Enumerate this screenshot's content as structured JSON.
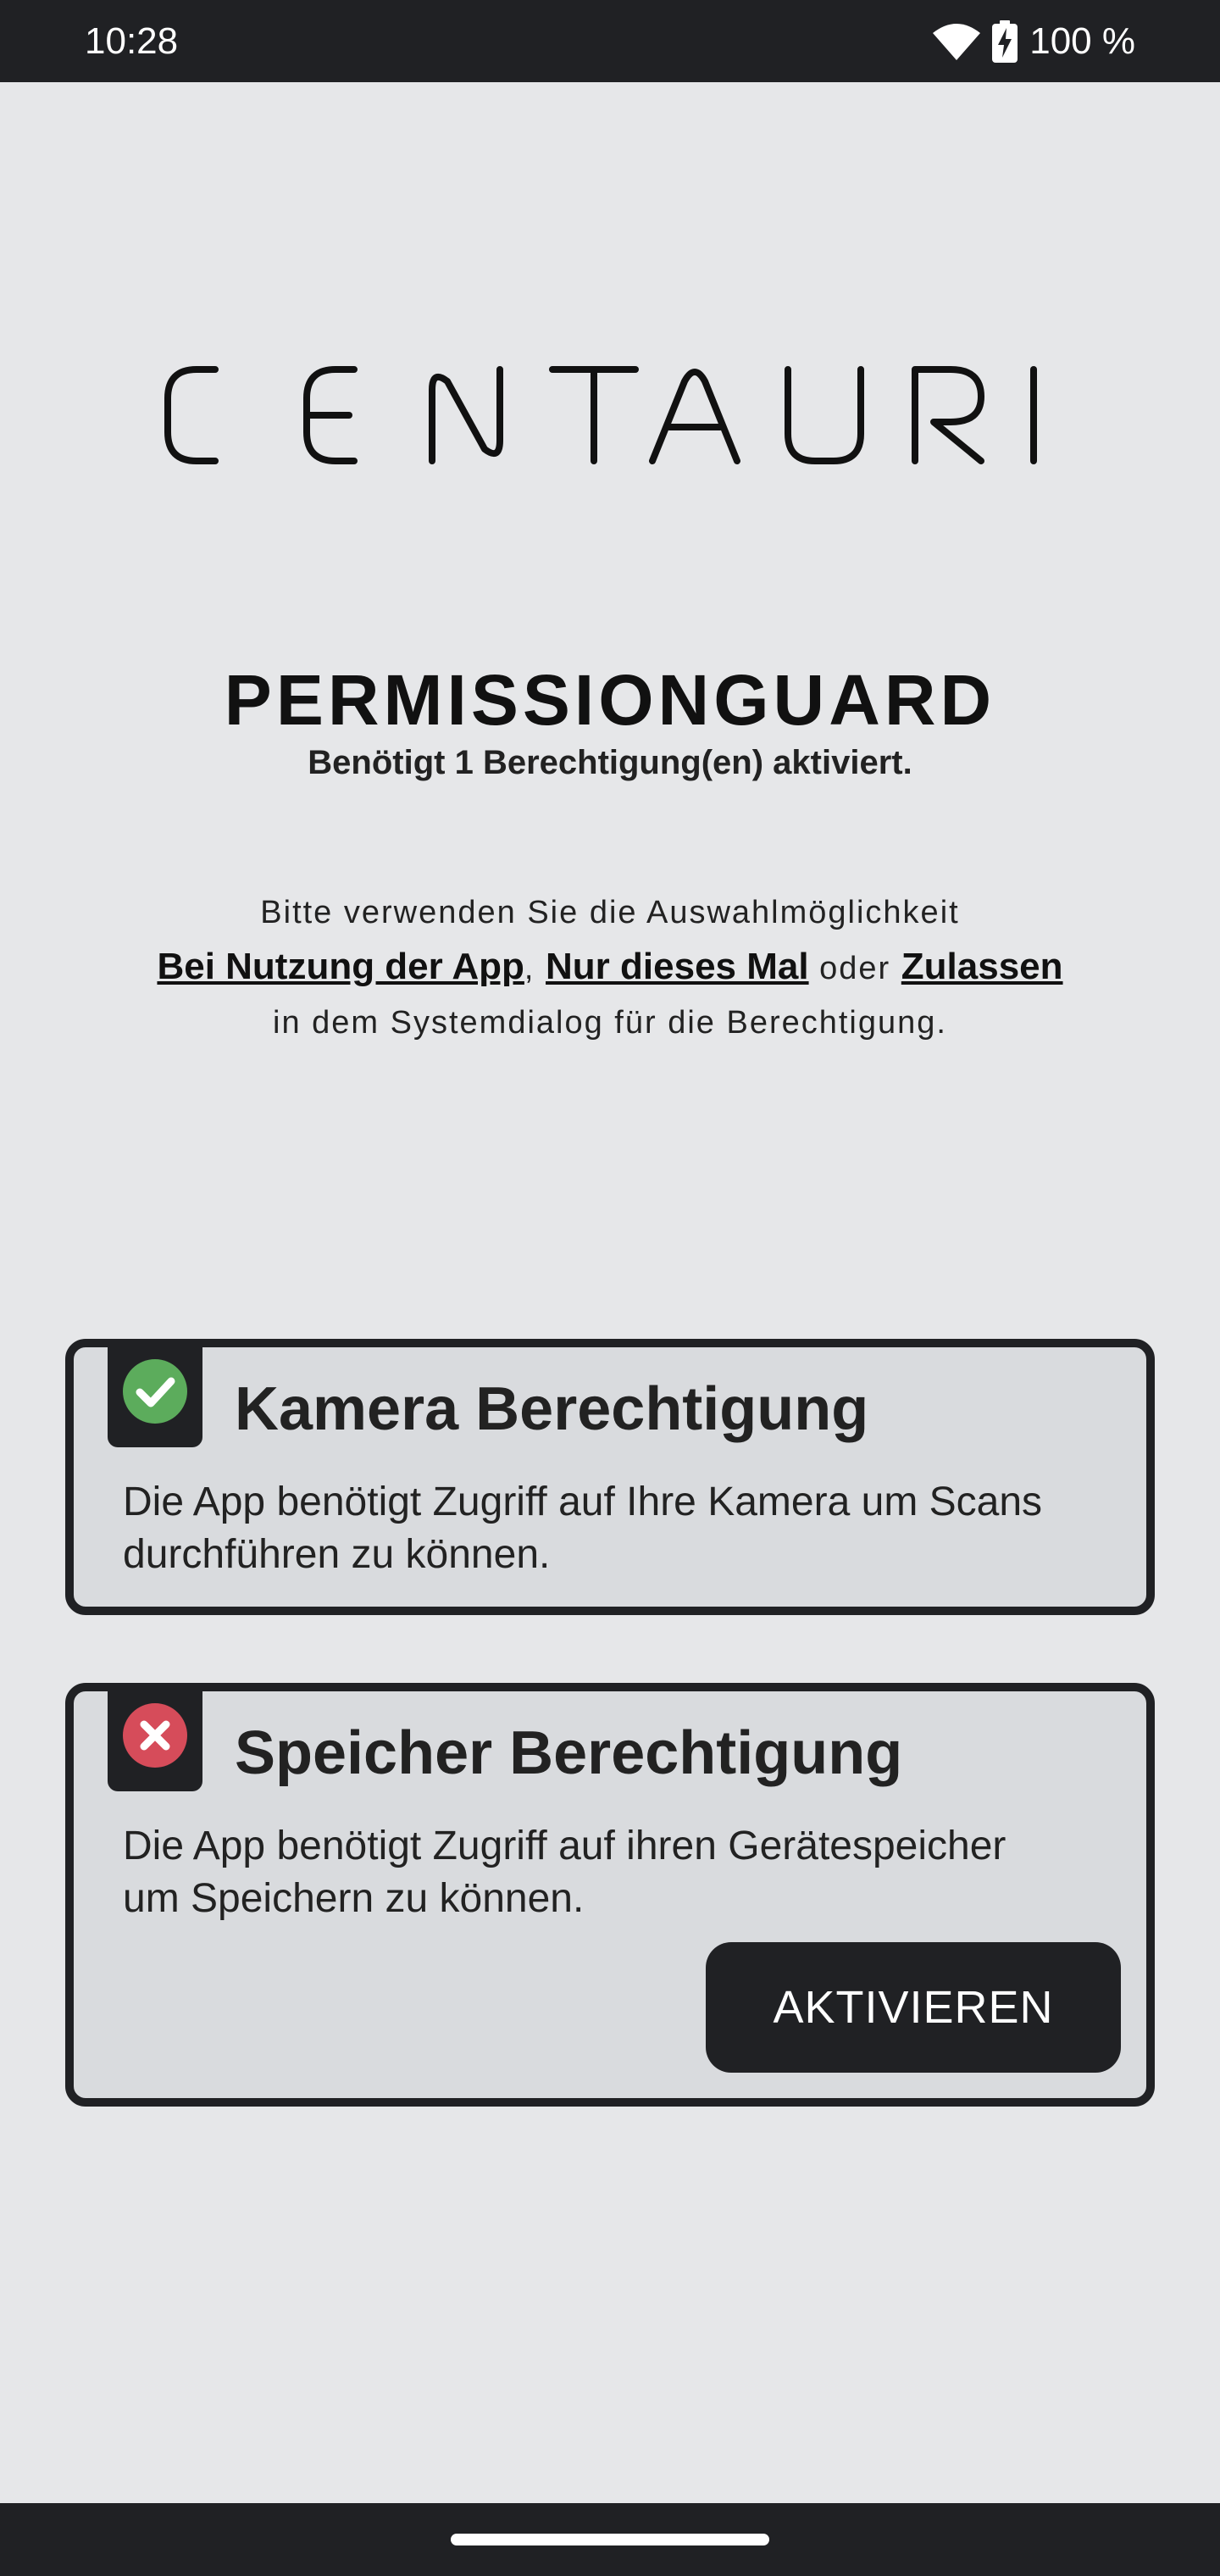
{
  "status_bar": {
    "time": "10:28",
    "battery": "100 %",
    "icons": [
      "wifi-icon",
      "battery-charging-icon"
    ]
  },
  "logo": {
    "text": "CENTAURI"
  },
  "header": {
    "title": "PERMISSIONGUARD",
    "subtitle": "Benötigt 1 Berechtigung(en) aktiviert."
  },
  "instructions": {
    "line1": "Bitte verwenden Sie die Auswahlmöglichkeit",
    "option1": "Bei Nutzung der App",
    "comma": ",",
    "option2": "Nur dieses Mal",
    "or": "oder",
    "option3": "Zulassen",
    "line3": "in dem Systemdialog für die Berechtigung."
  },
  "permissions": [
    {
      "title": "Kamera Berechtigung",
      "description": "Die App benötigt Zugriff auf Ihre Kamera um Scans durchführen zu können.",
      "granted": true,
      "icon": "check-circle-icon",
      "status_color": "#5cac5c"
    },
    {
      "title": "Speicher Berechtigung",
      "description": "Die App benötigt Zugriff auf ihren Gerätespeicher um Speichern zu können.",
      "granted": false,
      "icon": "error-circle-icon",
      "status_color": "#d64c5a",
      "button_label": "AKTIVIEREN"
    }
  ],
  "colors": {
    "background": "#e6e7e9",
    "bars": "#202124",
    "card": "#d9dbde",
    "granted": "#5cac5c",
    "denied": "#d64c5a"
  }
}
